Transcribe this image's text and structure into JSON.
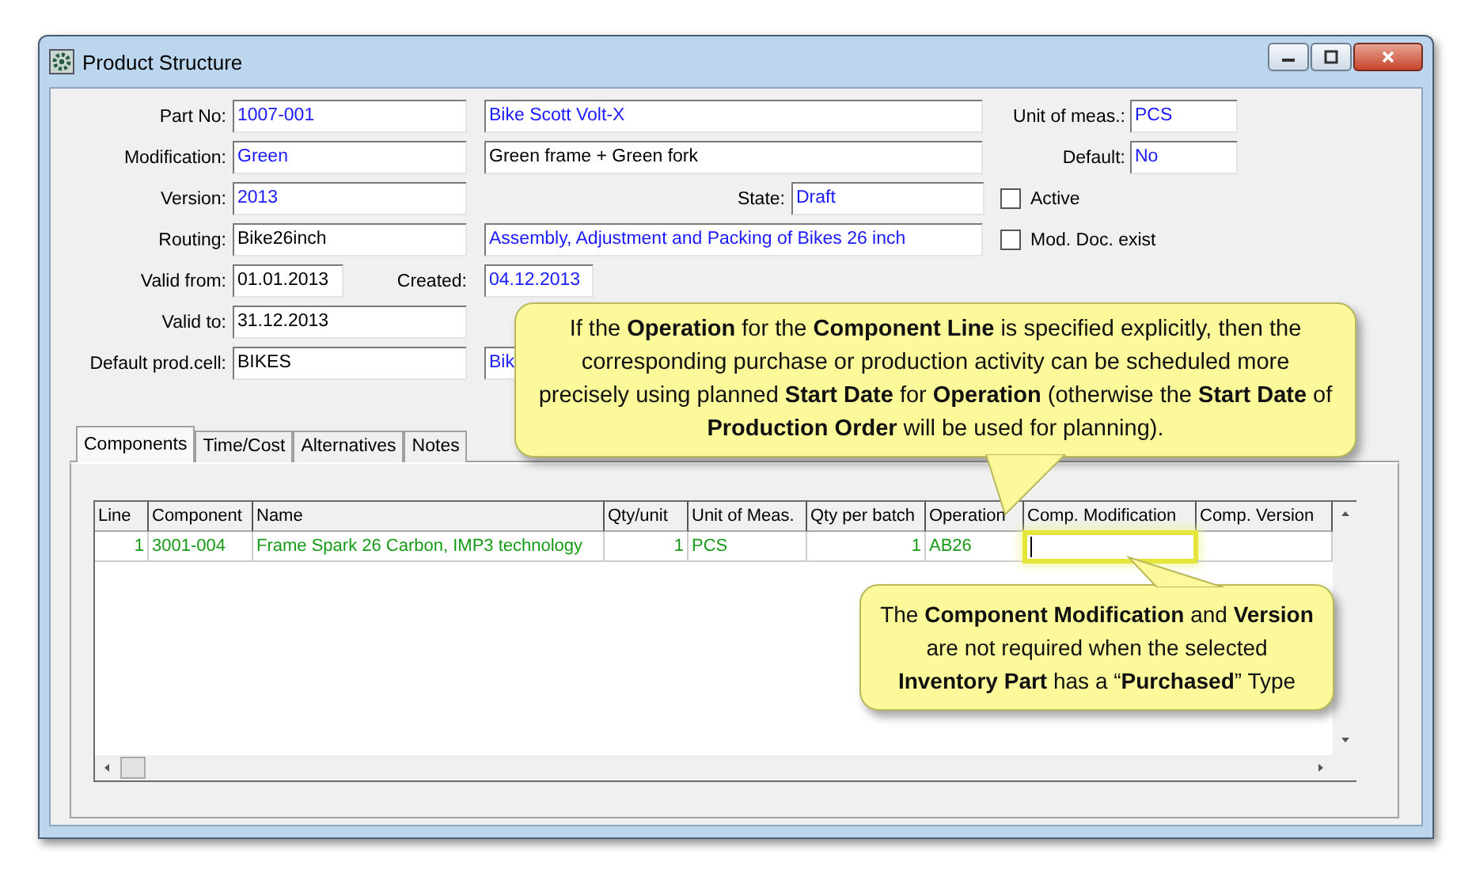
{
  "window": {
    "title": "Product Structure"
  },
  "form": {
    "rows": [
      {
        "label": "Part No:",
        "value": "1007-001",
        "linked": true,
        "description": "Bike Scott Volt-X",
        "description_linked": true
      },
      {
        "label": "Modification:",
        "value": "Green",
        "linked": true,
        "description": "Green frame + Green fork",
        "description_linked": false
      },
      {
        "label": "Version:",
        "value": "2013",
        "linked": true,
        "state_label": "State:",
        "state": "Draft"
      },
      {
        "label": "Routing:",
        "value": "Bike26inch",
        "linked": false,
        "description": "Assembly, Adjustment and Packing of Bikes 26 inch",
        "description_linked": true
      },
      {
        "label": "Valid from:",
        "value": "01.01.2013",
        "linked": false,
        "created_label": "Created:",
        "created": "04.12.2013"
      },
      {
        "label": "Valid to:",
        "value": "31.12.2013",
        "linked": false
      },
      {
        "label": "Default prod.cell:",
        "value": "BIKES",
        "linked": false,
        "description": "Bik",
        "description_linked": true
      }
    ],
    "side_fields": [
      {
        "label": "Unit of meas.:",
        "value": "PCS"
      },
      {
        "label": "Default:",
        "value": "No"
      }
    ],
    "checkboxes": [
      {
        "label": "Active",
        "checked": false
      },
      {
        "label": "Mod. Doc. exist",
        "checked": false
      }
    ]
  },
  "tabs": [
    {
      "label": "Components",
      "selected": true
    },
    {
      "label": "Time/Cost",
      "selected": false
    },
    {
      "label": "Alternatives",
      "selected": false
    },
    {
      "label": "Notes",
      "selected": false
    }
  ],
  "table": {
    "columns": [
      "Line",
      "Component",
      "Name",
      "Qty/unit",
      "Unit of Meas.",
      "Qty per batch",
      "Operation",
      "Comp. Modification",
      "Comp. Version"
    ],
    "rows": [
      {
        "cells": [
          "1",
          "3001-004",
          "Frame Spark 26 Carbon, IMP3 technology",
          "1",
          "PCS",
          "1",
          "AB26",
          "",
          ""
        ]
      }
    ]
  },
  "callouts": [
    {
      "text": "If the **Operation** for the **Component Line** is specified explicitly, then the corresponding purchase or production activity can be scheduled more precisely using planned **Start Date** for **Operation** (otherwise the **Start Date** of **Production Order** will be used for planning)."
    },
    {
      "text": "The **Component Modification** and **Version** are not required when the selected **Inventory Part** has a “**Purchased**” Type"
    }
  ]
}
